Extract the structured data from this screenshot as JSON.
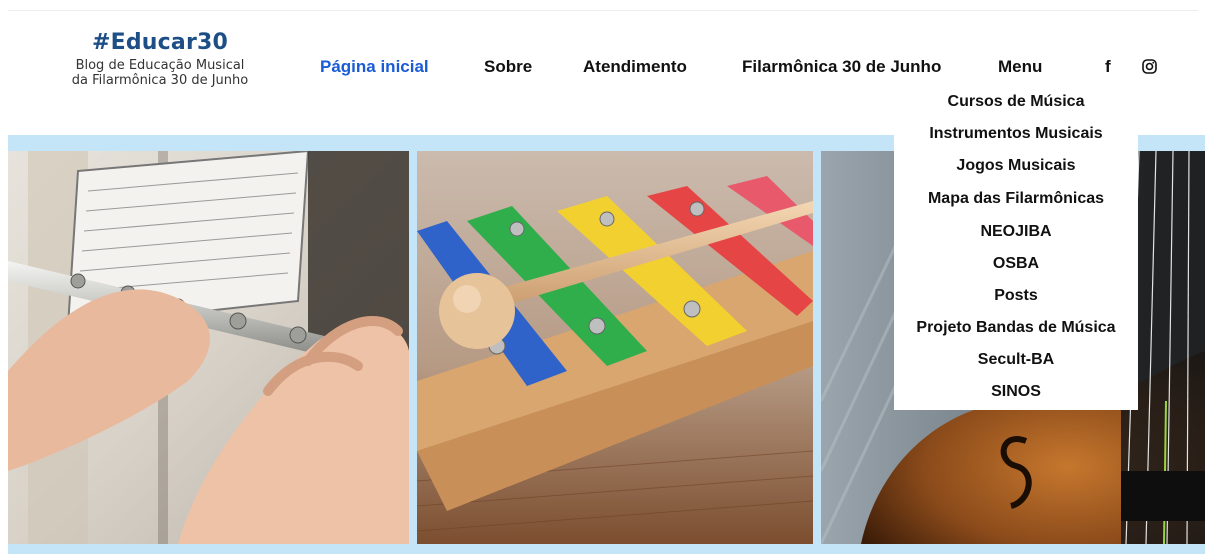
{
  "logo": {
    "title": "#Educar30",
    "subtitle_line1": "Blog de Educação Musical",
    "subtitle_line2": "da Filarmônica 30 de Junho"
  },
  "nav": {
    "items": [
      {
        "label": "Página inicial",
        "active": true
      },
      {
        "label": "Sobre"
      },
      {
        "label": "Atendimento"
      },
      {
        "label": "Filarmônica 30 de Junho"
      },
      {
        "label": "Menu"
      }
    ]
  },
  "social": {
    "facebook_glyph": "f",
    "facebook_icon": "facebook-icon",
    "instagram_icon": "instagram-icon"
  },
  "menu_dropdown": {
    "items": [
      "Cursos de Música",
      "Instrumentos Musicais",
      "Jogos Musicais",
      "Mapa das Filarmônicas",
      "NEOJIBA",
      "OSBA",
      "Posts",
      "Projeto Bandas de Música",
      "Secult-BA",
      "SINOS"
    ]
  },
  "gallery": {
    "images": [
      "flute-photo",
      "xylophone-photo",
      "violin-photo"
    ]
  },
  "colors": {
    "brand": "#1d4f86",
    "active_nav": "#1a5bd6",
    "band": "#c3e5f7"
  }
}
